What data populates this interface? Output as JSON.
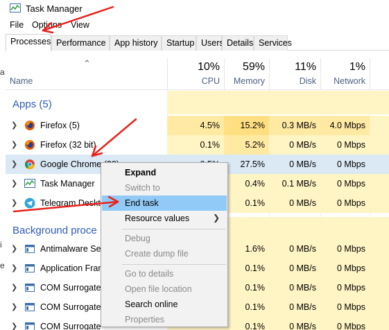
{
  "window": {
    "title": "Task Manager"
  },
  "menu": {
    "file": "File",
    "options": "Options",
    "view": "View"
  },
  "tabs": [
    {
      "label": "Processes"
    },
    {
      "label": "Performance"
    },
    {
      "label": "App history"
    },
    {
      "label": "Startup"
    },
    {
      "label": "Users"
    },
    {
      "label": "Details"
    },
    {
      "label": "Services"
    }
  ],
  "columns": {
    "name": "Name",
    "cpu": {
      "pct": "10%",
      "label": "CPU"
    },
    "memory": {
      "pct": "59%",
      "label": "Memory"
    },
    "disk": {
      "pct": "11%",
      "label": "Disk"
    },
    "network": {
      "pct": "1%",
      "label": "Network"
    }
  },
  "sections": {
    "apps": "Apps (5)",
    "background": "Background proce"
  },
  "apps": [
    {
      "name": "Firefox (5)",
      "cpu": "4.5%",
      "memory": "15.2%",
      "disk": "0.3 MB/s",
      "network": "4.0 Mbps",
      "icon": "firefox-icon"
    },
    {
      "name": "Firefox (32 bit)",
      "cpu": "0.1%",
      "memory": "5.2%",
      "disk": "0 MB/s",
      "network": "0 Mbps",
      "icon": "firefox-icon"
    },
    {
      "name": "Google Chrome (28)",
      "cpu": "0.5%",
      "memory": "27.5%",
      "disk": "0 MB/s",
      "network": "0 Mbps",
      "icon": "chrome-icon"
    },
    {
      "name": "Task Manager",
      "cpu": "",
      "memory": "0.4%",
      "disk": "0.1 MB/s",
      "network": "0 Mbps",
      "icon": "task-manager-icon"
    },
    {
      "name": "Telegram Deskto",
      "cpu": "",
      "memory": "0.1%",
      "disk": "0 MB/s",
      "network": "0 Mbps",
      "icon": "telegram-icon"
    }
  ],
  "background": [
    {
      "name": "Antimalware Ser",
      "memory": "1.6%",
      "disk": "0 MB/s",
      "network": "0 Mbps"
    },
    {
      "name": "Application Fran",
      "memory": "0.1%",
      "disk": "0 MB/s",
      "network": "0 Mbps"
    },
    {
      "name": "COM Surrogate",
      "memory": "0.1%",
      "disk": "0 MB/s",
      "network": "0 Mbps"
    },
    {
      "name": "COM Surrogate",
      "memory": "0.1%",
      "disk": "0 MB/s",
      "network": "0 Mbps"
    },
    {
      "name": "COM Surrogate",
      "memory": "0.1%",
      "disk": "0 MB/s",
      "network": "0 Mbps"
    }
  ],
  "context_menu": {
    "expand": "Expand",
    "switch_to": "Switch to",
    "end_task": "End task",
    "resource_values": "Resource values",
    "debug": "Debug",
    "create_dump": "Create dump file",
    "go_to_details": "Go to details",
    "open_file_location": "Open file location",
    "search_online": "Search online",
    "properties": "Properties"
  },
  "colors": {
    "accent": "#2d5bb5",
    "annotation": "#e8211d",
    "highlight": "#91c9f7",
    "heat": "#fff4c4"
  }
}
